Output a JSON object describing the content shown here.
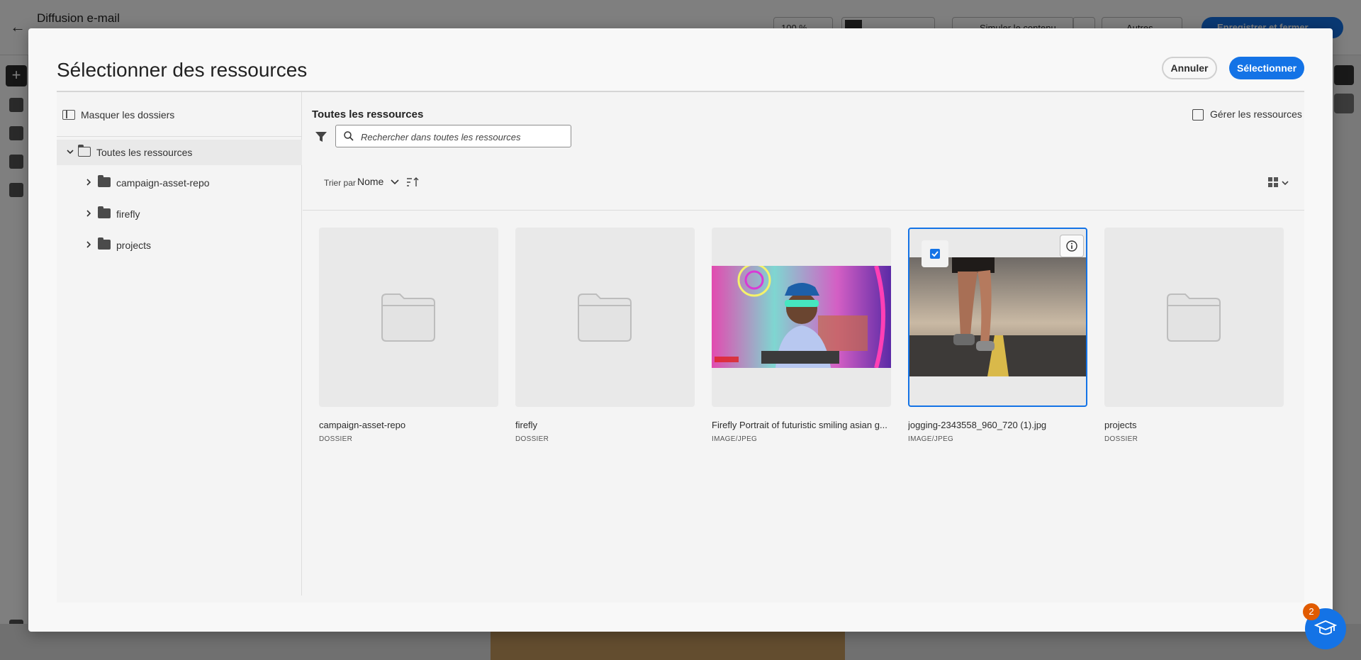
{
  "app": {
    "title": "Diffusion e-mail",
    "zoom": "100 %",
    "simulate_label": "Simuler le contenu",
    "more_label": "Autres choix",
    "save_label": "Enregistrer et fermer"
  },
  "modal": {
    "title": "Sélectionner des ressources",
    "cancel_label": "Annuler",
    "select_label": "Sélectionner"
  },
  "tree": {
    "hide_label": "Masquer les dossiers",
    "root_label": "Toutes les ressources",
    "children": [
      {
        "label": "campaign-asset-repo"
      },
      {
        "label": "firefly"
      },
      {
        "label": "projects"
      }
    ]
  },
  "content": {
    "title": "Toutes les ressources",
    "manage_label": "Gérer les ressources",
    "search_placeholder": "Rechercher dans toutes les ressources",
    "sort_label": "Trier par",
    "sort_value": "Nome"
  },
  "assets": [
    {
      "name": "campaign-asset-repo",
      "type": "DOSSIER",
      "kind": "folder",
      "selected": false
    },
    {
      "name": "firefly",
      "type": "DOSSIER",
      "kind": "folder",
      "selected": false
    },
    {
      "name": "Firefly Portrait of futuristic smiling asian g...",
      "type": "IMAGE/JPEG",
      "kind": "image",
      "selected": false
    },
    {
      "name": "jogging-2343558_960_720 (1).jpg",
      "type": "IMAGE/JPEG",
      "kind": "image",
      "selected": true
    },
    {
      "name": "projects",
      "type": "DOSSIER",
      "kind": "folder",
      "selected": false
    }
  ],
  "help": {
    "badge_count": "2"
  },
  "colors": {
    "accent": "#1473e6",
    "badge": "#e15b00"
  }
}
